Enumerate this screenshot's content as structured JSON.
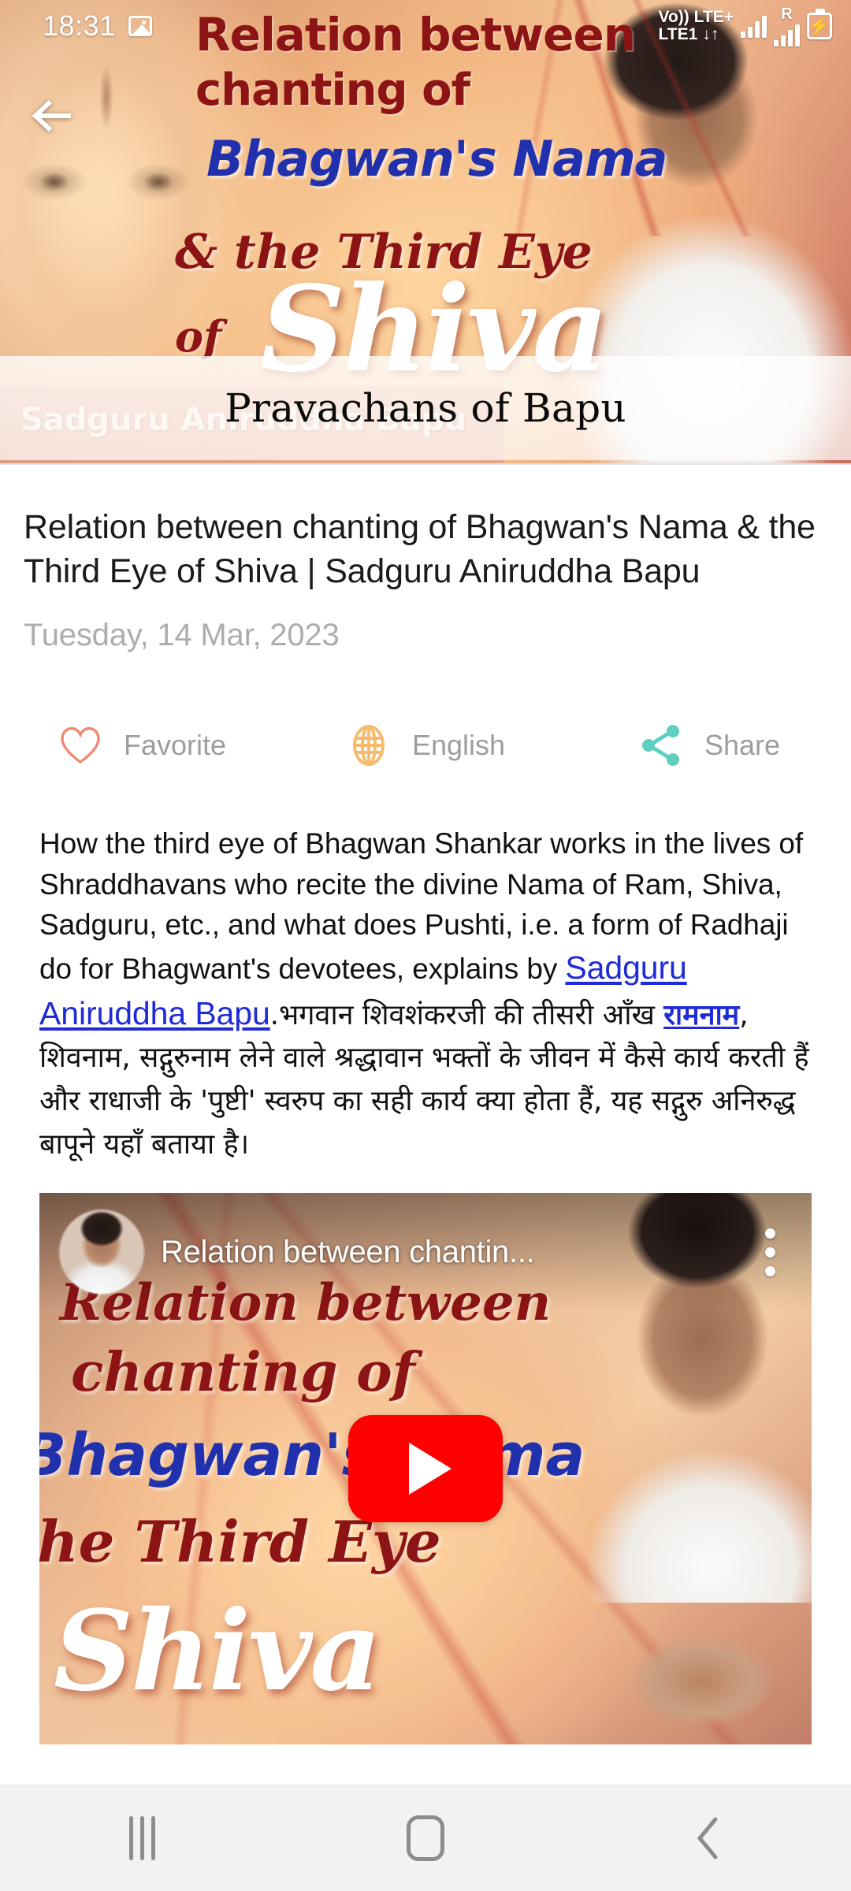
{
  "status_bar": {
    "time": "18:31",
    "gallery_icon": "gallery-icon",
    "volte_line1": "Vo)) LTE+",
    "volte_line2": "LTE1",
    "data_arrows": "↓↑",
    "roaming": "R",
    "battery_icon": "battery-charging-icon",
    "battery_bolt": "⚡"
  },
  "header": {
    "back_icon": "back-arrow-icon",
    "page_title": "Pravachans of Bapu",
    "banner": {
      "line1": "Relation between",
      "line2": "chanting of",
      "line3": "Bhagwan's Nama",
      "line4": "& the Third Eye",
      "line5_of": "of",
      "line5_shiva": "Shiva",
      "credit": "Sadguru Aniruddha Bapu"
    }
  },
  "main": {
    "video_title": "Relation between chanting of Bhagwan's Nama & the Third Eye of Shiva | Sadguru Aniruddha Bapu",
    "date": "Tuesday, 14 Mar, 2023",
    "actions": [
      {
        "id": "favorite",
        "label": "Favorite",
        "icon": "heart-outline-icon",
        "color": "#ef8a70"
      },
      {
        "id": "language",
        "label": "English",
        "icon": "globe-icon",
        "color": "#f5bc6e"
      },
      {
        "id": "share",
        "label": "Share",
        "icon": "share-icon",
        "color": "#5ecfc0"
      }
    ],
    "description": {
      "english_part1": "How the third eye of Bhagwan Shankar works in the lives of Shraddhavans who recite the divine Nama of Ram, Shiva, Sadguru, etc., and what does Pushti, i.e. a form of Radhaji do for Bhagwant's devotees, explains by ",
      "link_text": "Sadguru  Aniruddha Bapu",
      "hindi_part1": ".भगवान शिवशंकरजी की तीसरी आँख ",
      "hindi_link": "रामनाम",
      "hindi_part2": ", शिवनाम, सद्गुरुनाम लेने वाले श्रद्धावान भक्तों के जीवन में कैसे कार्य करती हैं और राधाजी के 'पुष्टी' स्वरुप का सही कार्य क्या होता हैं, यह सद्गुरु अनिरुद्ध बापूने यहाँ बताया है।",
      "link_color": "#1f2bd6"
    },
    "video_embed": {
      "avatar": "channel-avatar",
      "title": "Relation between chantin...",
      "menu_icon": "kebab-menu-icon",
      "play_icon": "youtube-play-icon",
      "play_color": "#ff0000",
      "thumb_line1": "Relation between",
      "thumb_line2": "chanting of",
      "thumb_line3": "Bhagwan's Nama",
      "thumb_line4": "the Third Eye",
      "thumb_line5": "Shiva"
    }
  },
  "nav_bar": {
    "recents_icon": "recents-icon",
    "home_icon": "home-icon",
    "back_icon": "back-icon"
  }
}
